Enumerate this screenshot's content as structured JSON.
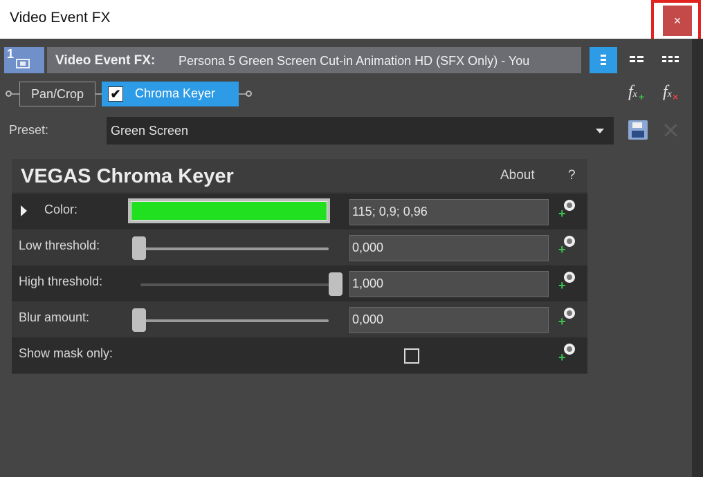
{
  "window": {
    "title": "Video Event FX",
    "close_label": "×"
  },
  "header": {
    "track_number": "1",
    "label": "Video Event FX:",
    "media_name": "Persona 5 Green Screen Cut-in Animation HD (SFX Only) - You"
  },
  "chain": {
    "items": [
      {
        "label": "Pan/Crop",
        "active": false
      },
      {
        "label": "Chroma Keyer",
        "active": true,
        "checked": true,
        "check_glyph": "✔"
      }
    ]
  },
  "preset": {
    "label": "Preset:",
    "value": "Green Screen"
  },
  "plugin": {
    "name": "VEGAS Chroma Keyer",
    "about": "About",
    "help": "?",
    "params": [
      {
        "label": "Color:",
        "value": "115; 0,9; 0,96",
        "swatch_color": "#20e020"
      },
      {
        "label": "Low threshold:",
        "value": "0,000",
        "slider": 0.0
      },
      {
        "label": "High threshold:",
        "value": "1,000",
        "slider": 1.0
      },
      {
        "label": "Blur amount:",
        "value": "0,000",
        "slider": 0.0
      },
      {
        "label": "Show mask only:",
        "checked": false
      }
    ]
  },
  "colors": {
    "accent": "#2d9be6",
    "close": "#c44a4a",
    "highlight": "#e0231f"
  }
}
